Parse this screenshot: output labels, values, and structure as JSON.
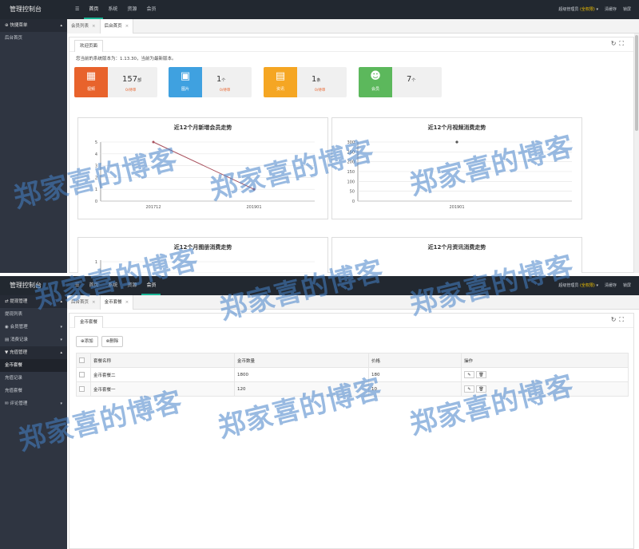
{
  "shot1": {
    "brand": "管理控制台",
    "top_nav": [
      "☰",
      "首页",
      "系统",
      "资源",
      "会员"
    ],
    "top_right": {
      "role_prefix": "超级管理员",
      "role": "(全权限)",
      "clear_cache": "清缓存",
      "lock": "锁屏"
    },
    "sidebar": {
      "head": "快捷菜单",
      "items": [
        "后台首页"
      ]
    },
    "tabs": [
      "会员列表",
      "后台首页"
    ],
    "panel_tab": "欢迎页面",
    "notice": "您当前的系统版本为：1.13.30，当前为最新版本。",
    "stats": [
      {
        "label": "视频",
        "value": "157",
        "unit": "部",
        "link": "0/待审",
        "color": "#e8632c",
        "icon": "film-icon"
      },
      {
        "label": "图片",
        "value": "1",
        "unit": "个",
        "link": "0/待审",
        "color": "#3fa1e0",
        "icon": "image-icon"
      },
      {
        "label": "资讯",
        "value": "1",
        "unit": "条",
        "link": "0/待审",
        "color": "#f5a623",
        "icon": "document-icon"
      },
      {
        "label": "会员",
        "value": "7",
        "unit": "个",
        "link": "",
        "color": "#5cb85c",
        "icon": "users-icon"
      }
    ]
  },
  "chart_data": [
    {
      "type": "line",
      "title": "近12个月新增会员走势",
      "categories": [
        "201712",
        "201901"
      ],
      "values": [
        5,
        1
      ],
      "y_ticks": [
        "0",
        "1",
        "2",
        "3",
        "4",
        "5"
      ],
      "ylim": [
        0,
        5
      ],
      "line_color": "#a8505c"
    },
    {
      "type": "scatter",
      "title": "近12个月视频消费走势",
      "categories": [
        "201901"
      ],
      "values": [
        300
      ],
      "y_ticks": [
        "0",
        "50",
        "100",
        "150",
        "200",
        "250",
        "300"
      ],
      "ylim": [
        0,
        300
      ]
    },
    {
      "type": "line",
      "title": "近12个月图册消费走势",
      "categories": [],
      "values": [],
      "y_ticks": [
        "1"
      ],
      "ylim": [
        0,
        1
      ]
    },
    {
      "type": "line",
      "title": "近12个月资讯消费走势",
      "categories": [],
      "values": [],
      "y_ticks": [],
      "ylim": [
        0,
        1
      ]
    }
  ],
  "shot2": {
    "brand": "管理控制台",
    "top_nav": [
      "☰",
      "首页",
      "系统",
      "资源",
      "会员"
    ],
    "top_right": {
      "role_prefix": "超级管理员",
      "role": "(全权限)",
      "clear_cache": "清缓存",
      "lock": "锁屏"
    },
    "sidebar": [
      {
        "label": "提现管理",
        "type": "head",
        "caret": "▴"
      },
      {
        "label": "提现列表",
        "type": "item",
        "caret": ""
      },
      {
        "label": "会员管理",
        "type": "head2",
        "caret": "▾"
      },
      {
        "label": "消费记录",
        "type": "head2",
        "caret": "▾"
      },
      {
        "label": "充值管理",
        "type": "head",
        "caret": "▴"
      },
      {
        "label": "金币套餐",
        "type": "sel",
        "caret": ""
      },
      {
        "label": "充值记录",
        "type": "item",
        "caret": ""
      },
      {
        "label": "充值套餐",
        "type": "item",
        "caret": ""
      },
      {
        "label": "评论管理",
        "type": "head2",
        "caret": "▾"
      }
    ],
    "tabs": [
      "后台首页",
      "金币套餐"
    ],
    "panel_tab": "金币套餐",
    "buttons": {
      "add": "⊕添加",
      "delete": "⊗删除"
    },
    "table": {
      "headers": [
        "",
        "套餐名称",
        "金币数量",
        "价格",
        "操作"
      ],
      "rows": [
        [
          "",
          "金币套餐二",
          "1800",
          "180",
          ""
        ],
        [
          "",
          "金币套餐一",
          "120",
          "10",
          ""
        ]
      ]
    }
  },
  "watermark": "郑家喜的博客"
}
